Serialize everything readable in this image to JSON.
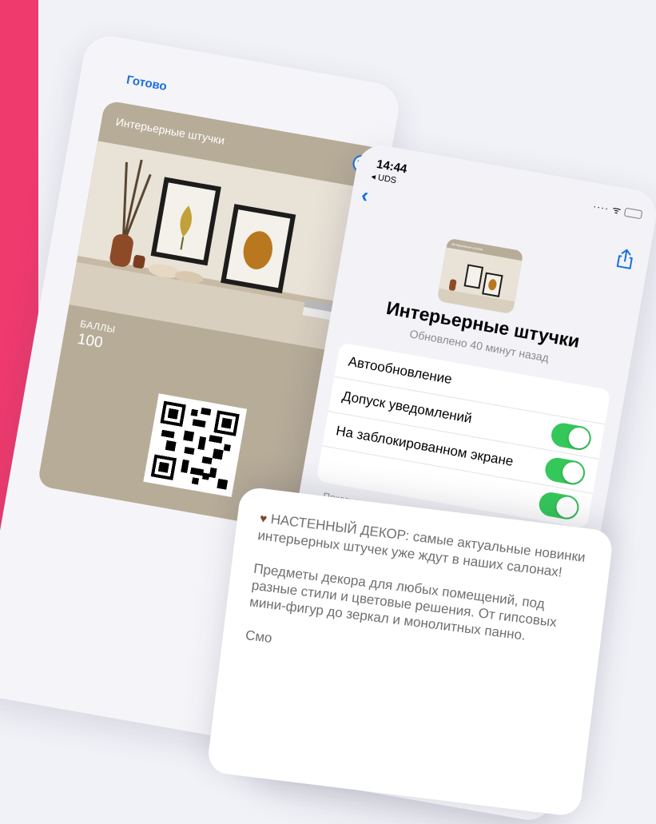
{
  "back_screen": {
    "done_label": "Готово",
    "pass": {
      "title": "Интерьерные штучки",
      "more_icon": "ellipsis-circle-icon",
      "points_label": "БАЛЛЫ",
      "points_value": "100"
    }
  },
  "front_phone": {
    "status": {
      "time": "14:44",
      "back_app": "◂ UDS",
      "icons": "···· ᯤ"
    },
    "nav": {
      "back_icon": "‹",
      "share_icon": "share-icon"
    },
    "card_mini_title": "Интерьерные штучки",
    "title": "Интерьерные штучки",
    "subtitle": "Обновлено 40 минут назад",
    "settings": [
      {
        "label": "Автообновление",
        "toggle": true
      },
      {
        "label": "Допуск уведомлений",
        "toggle": true
      },
      {
        "label": "На заблокированном экране",
        "toggle": true
      }
    ],
    "footnote": "Показывать карту на основании времени или геопозиции"
  },
  "message": {
    "heart": "♥",
    "text": "НАСТЕННЫЙ ДЕКОР: самые актуальные новинки интерьерных штучек уже ждут в наших салонах!\n\nПредметы декора для любых помещений, под разные стили и цветовые решения. От гипсовых мини-фигур до зеркал и монолитных панно.\n\nСмо"
  },
  "colors": {
    "accent": "#ef3a6e",
    "link": "#1a6fe0",
    "toggle_on": "#34c759",
    "card": "#b7ac98"
  }
}
